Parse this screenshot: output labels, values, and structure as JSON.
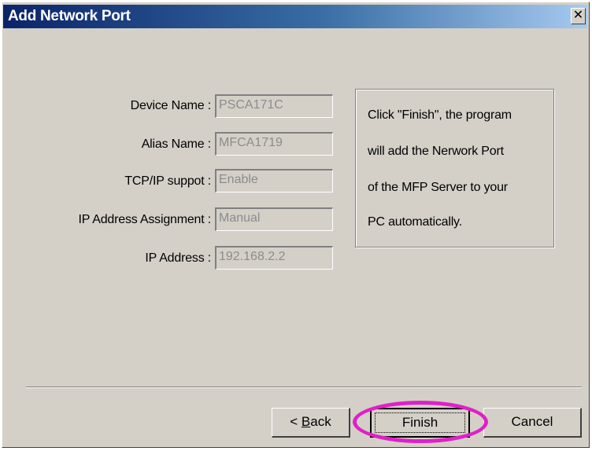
{
  "window": {
    "title": "Add Network Port",
    "close_glyph": "✕"
  },
  "fields": [
    {
      "label": "Device Name :",
      "value": "PSCA171C"
    },
    {
      "label": "Alias Name :",
      "value": "MFCA1719"
    },
    {
      "label": "TCP/IP suppot :",
      "value": "Enable"
    },
    {
      "label": "IP Address Assignment :",
      "value": "Manual"
    },
    {
      "label": "IP Address :",
      "value": "192.168.2.2"
    }
  ],
  "info": {
    "lines": [
      "Click \"Finish\", the program",
      "will add the Nerwork Port",
      "of the MFP Server to your",
      "PC automatically."
    ]
  },
  "buttons": {
    "back_prefix": "< ",
    "back_accel": "B",
    "back_rest": "ack",
    "finish": "Finish",
    "cancel": "Cancel"
  },
  "colors": {
    "highlight": "#e020c8",
    "title_bar": "#0a246a"
  }
}
